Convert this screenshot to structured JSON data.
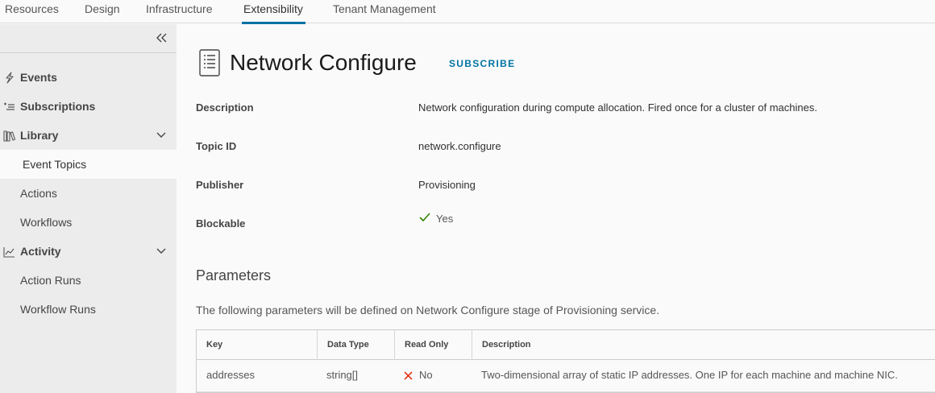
{
  "topnav": {
    "tabs": [
      {
        "label": "Resources"
      },
      {
        "label": "Design"
      },
      {
        "label": "Infrastructure"
      },
      {
        "label": "Extensibility"
      },
      {
        "label": "Tenant Management"
      }
    ],
    "active": "Extensibility"
  },
  "sidebar": {
    "collapse_icon": "double-chevron-left-icon",
    "items": [
      {
        "label": "Events",
        "icon": "lightning-icon"
      },
      {
        "label": "Subscriptions",
        "icon": "subscription-list-icon"
      },
      {
        "label": "Library",
        "icon": "library-icon"
      },
      {
        "label": "Event Topics"
      },
      {
        "label": "Actions"
      },
      {
        "label": "Workflows"
      },
      {
        "label": "Activity",
        "icon": "activity-chart-icon"
      },
      {
        "label": "Action Runs"
      },
      {
        "label": "Workflow Runs"
      }
    ],
    "selected": "Event Topics"
  },
  "main": {
    "title": "Network Configure",
    "subscribe_label": "SUBSCRIBE",
    "properties": {
      "description_label": "Description",
      "description_value": "Network configuration during compute allocation. Fired once for a cluster of machines.",
      "topic_id_label": "Topic ID",
      "topic_id_value": "network.configure",
      "publisher_label": "Publisher",
      "publisher_value": "Provisioning",
      "blockable_label": "Blockable",
      "blockable_value": "Yes"
    },
    "parameters": {
      "title": "Parameters",
      "description": "The following parameters will be defined on Network Configure stage of Provisioning service.",
      "columns": [
        "Key",
        "Data Type",
        "Read Only",
        "Description"
      ],
      "rows": [
        {
          "key": "addresses",
          "data_type": "string[]",
          "read_only": "No",
          "description": "Two-dimensional array of static IP addresses. One IP for each machine and machine NIC."
        }
      ]
    }
  },
  "colors": {
    "accent": "#0072a3",
    "check": "#2f8400",
    "cross": "#e12200",
    "sidebar_bg": "#ececec"
  }
}
